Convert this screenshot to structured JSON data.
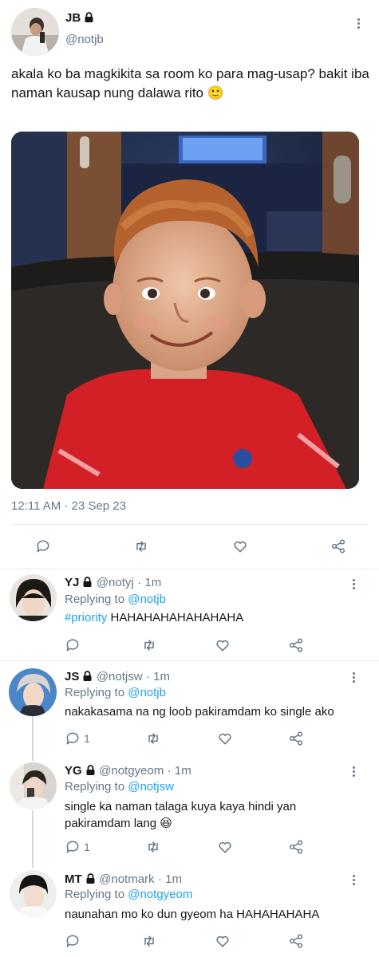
{
  "main_tweet": {
    "author_name": "JB",
    "author_handle": "@notjb",
    "text": "akala ko ba magkikita sa room ko para mag-usap? bakit iba naman kausap nung dalawa rito",
    "emoji": "🙂",
    "timestamp": "12:11 AM · 23 Sep 23"
  },
  "replies": [
    {
      "name": "YJ",
      "handle": "@notyj",
      "time": "· 1m",
      "replying_prefix": "Replying to",
      "replying_to": "@notjb",
      "hashtag": "#priority",
      "text": "HAHAHAHAHAHAHAHA",
      "reply_count": ""
    },
    {
      "name": "JS",
      "handle": "@notjsw",
      "time": "· 1m",
      "replying_prefix": "Replying to",
      "replying_to": "@notjb",
      "text": "nakakasama na ng loob pakiramdam ko single ako",
      "reply_count": "1"
    },
    {
      "name": "YG",
      "handle": "@notgyeom",
      "time": "· 1m",
      "replying_prefix": "Replying to",
      "replying_to": "@notjsw",
      "text": "single ka naman talaga kuya kaya hindi yan pakiramdam lang",
      "emoji": "😆",
      "reply_count": "1"
    },
    {
      "name": "MT",
      "handle": "@notmark",
      "time": "· 1m",
      "replying_prefix": "Replying to",
      "replying_to": "@notgyeom",
      "text": "naunahan mo ko dun gyeom ha HAHAHAHAHA",
      "reply_count": ""
    }
  ],
  "icons": [
    "lock-icon",
    "more-icon",
    "reply-icon",
    "retweet-icon",
    "like-icon",
    "share-icon"
  ],
  "colors": {
    "link": "#1da1f2",
    "muted": "#657786",
    "text": "#14171a",
    "divider": "#e6ecf0"
  }
}
